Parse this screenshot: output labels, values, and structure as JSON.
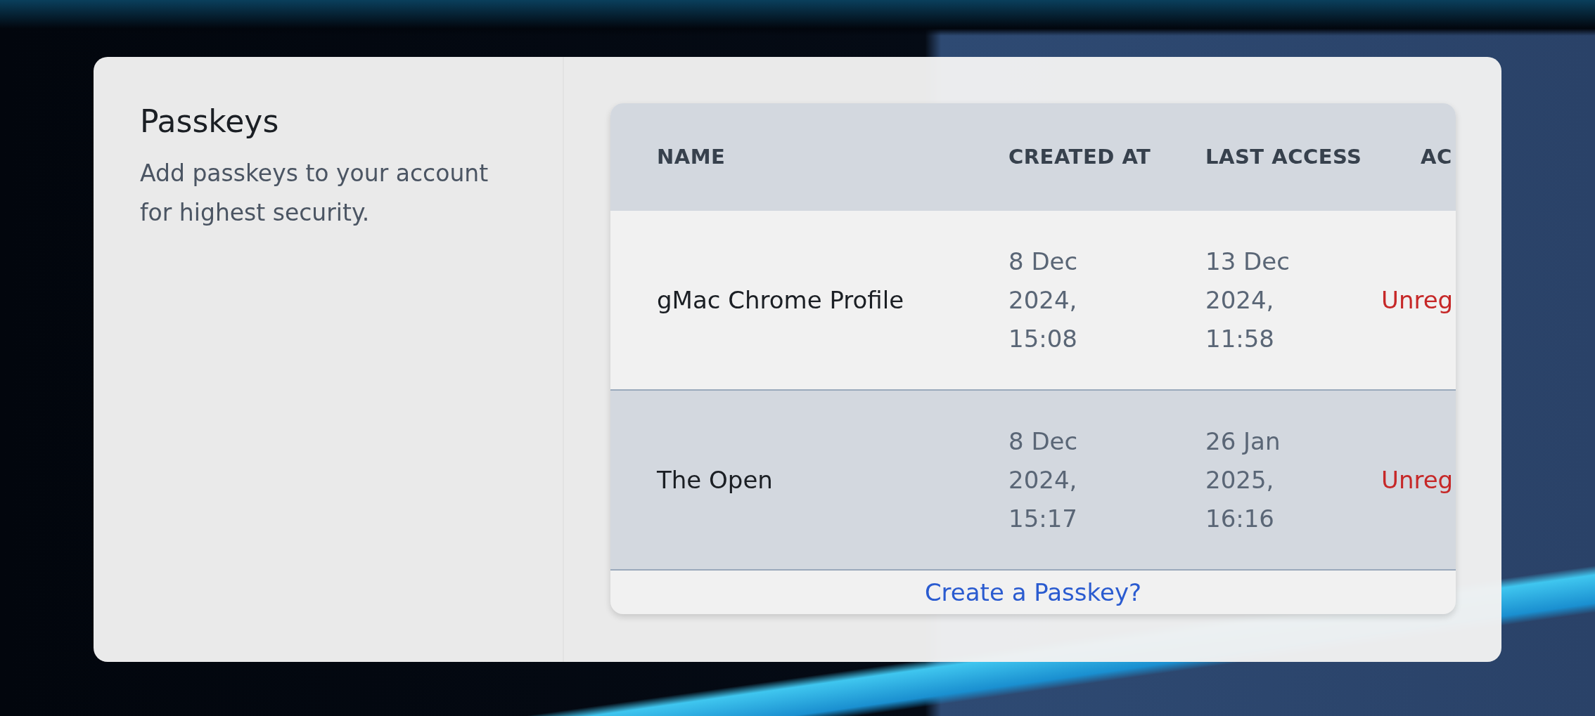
{
  "section": {
    "title": "Passkeys",
    "description": "Add passkeys to your account for highest security."
  },
  "table": {
    "columns": [
      {
        "label": "NAME"
      },
      {
        "label": "CREATED AT"
      },
      {
        "label": "LAST ACCESS"
      },
      {
        "label": "AC"
      }
    ],
    "rows": [
      {
        "name": "gMac Chrome Profile",
        "created_at": "8 Dec 2024, 15:08",
        "last_access": "13 Dec 2024, 11:58",
        "action": "Unreg",
        "shaded": false
      },
      {
        "name": "The Open",
        "created_at": "8 Dec 2024, 15:17",
        "last_access": "26 Jan 2025, 16:16",
        "action": "Unreg",
        "shaded": true
      }
    ],
    "footer_link": "Create a Passkey?"
  }
}
